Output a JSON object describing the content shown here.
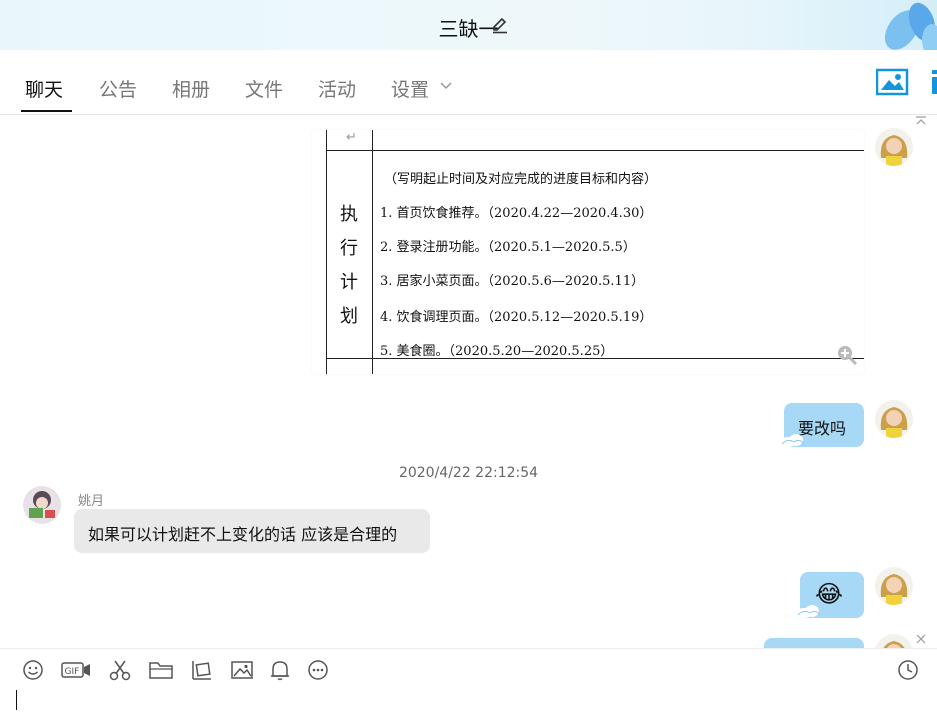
{
  "window": {
    "title": "三缺一"
  },
  "tabs": [
    {
      "label": "聊天",
      "active": true
    },
    {
      "label": "公告"
    },
    {
      "label": "相册"
    },
    {
      "label": "文件"
    },
    {
      "label": "活动"
    },
    {
      "label": "设置"
    }
  ],
  "doc_image": {
    "side_chars": [
      "执",
      "行",
      "计",
      "划"
    ],
    "header_line": "（写明起止时间及对应完成的进度目标和内容）",
    "items": [
      "1.  首页饮食推荐。（2020.4.22—2020.4.30）",
      "2.  登录注册功能。（2020.5.1—2020.5.5）",
      "3.  居家小菜页面。（2020.5.6—2020.5.11）",
      "4.  饮食调理页面。（2020.5.12—2020.5.19）",
      "5.  美食圈。（2020.5.20—2020.5.25）"
    ],
    "return_mark": "↵"
  },
  "messages": {
    "me_1": "要改吗",
    "timestamp": "2020/4/22 22:12:54",
    "other_sender": "姚月",
    "other_1": "如果可以计划赶不上变化的话 应该是合理的",
    "me_emoji": "😂"
  },
  "toolbar": {
    "icons": [
      "emoji-icon",
      "gif-icon",
      "scissors-icon",
      "folder-icon",
      "screenshot-icon",
      "image-icon",
      "bell-icon",
      "more-icon",
      "history-icon"
    ],
    "gif_label": "GIF"
  },
  "colors": {
    "my_bubble": "#a7d8f5",
    "other_bubble": "#e9e9e9",
    "accent": "#1296db"
  }
}
